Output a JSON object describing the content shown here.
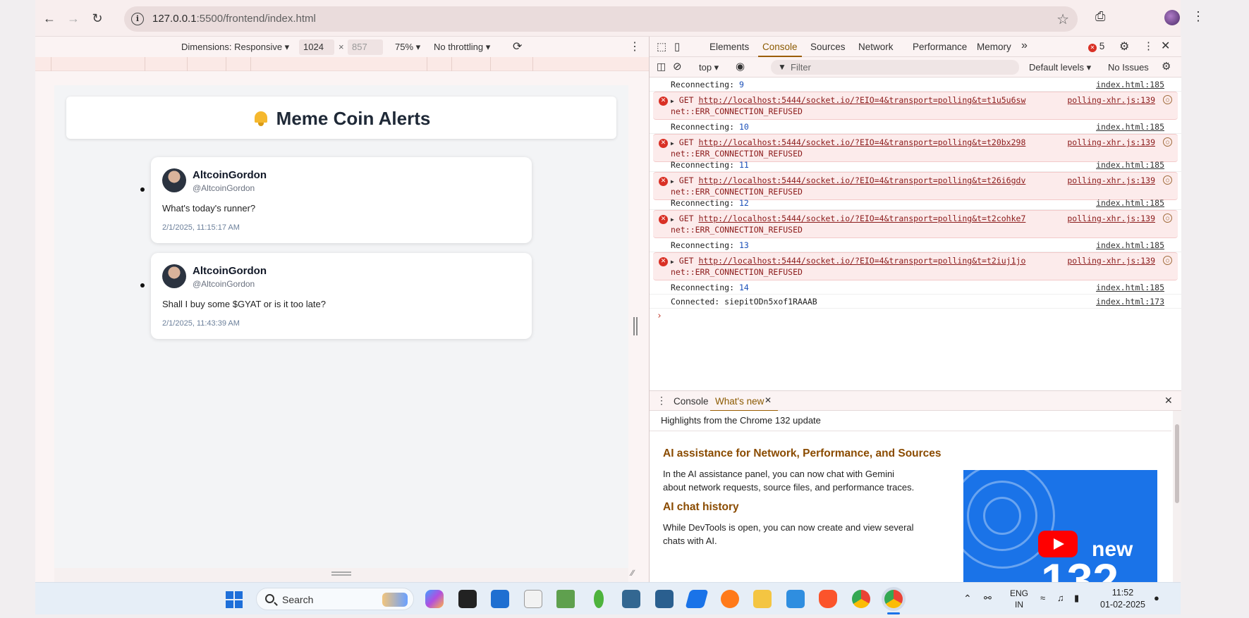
{
  "browser": {
    "url_host": "127.0.0.1",
    "url_path": ":5500/frontend/index.html"
  },
  "device_toolbar": {
    "dimensions_label": "Dimensions: Responsive ▾",
    "width": "1024",
    "x": "×",
    "height": "857",
    "zoom": "75% ▾",
    "throttling": "No throttling ▾"
  },
  "app": {
    "title": "Meme Coin Alerts",
    "tweets": [
      {
        "name": "AltcoinGordon",
        "handle": "@AltcoinGordon",
        "text": "What's today's runner?",
        "time": "2/1/2025, 11:15:17 AM"
      },
      {
        "name": "AltcoinGordon",
        "handle": "@AltcoinGordon",
        "text": "Shall I buy some $GYAT or is it too late?",
        "time": "2/1/2025, 11:43:39 AM"
      }
    ]
  },
  "devtools": {
    "tabs": [
      "Elements",
      "Console",
      "Sources",
      "Network",
      "Performance",
      "Memory"
    ],
    "more_tabs": "»",
    "error_count": "5",
    "context": "top ▾",
    "filter_placeholder": "Filter",
    "levels": "Default levels ▾",
    "issues": "No Issues",
    "logs": [
      {
        "type": "info",
        "prefix": "Reconnecting: ",
        "num": "9",
        "src": "index.html:185"
      },
      {
        "type": "err",
        "method": "GET",
        "url": "http://localhost:5444/socket.io/?EIO=4&transport=polling&t=t1u5u6sw",
        "detail": "net::ERR_CONNECTION_REFUSED",
        "src": "polling-xhr.js:139"
      },
      {
        "type": "info",
        "prefix": "Reconnecting: ",
        "num": "10",
        "src": "index.html:185"
      },
      {
        "type": "err",
        "method": "GET",
        "url": "http://localhost:5444/socket.io/?EIO=4&transport=polling&t=t20bx298",
        "detail": "net::ERR_CONNECTION_REFUSED",
        "src": "polling-xhr.js:139"
      },
      {
        "type": "info",
        "prefix": "Reconnecting: ",
        "num": "11",
        "src": "index.html:185"
      },
      {
        "type": "err",
        "method": "GET",
        "url": "http://localhost:5444/socket.io/?EIO=4&transport=polling&t=t26i6gdv",
        "detail": "net::ERR_CONNECTION_REFUSED",
        "src": "polling-xhr.js:139"
      },
      {
        "type": "info",
        "prefix": "Reconnecting: ",
        "num": "12",
        "src": "index.html:185"
      },
      {
        "type": "err",
        "method": "GET",
        "url": "http://localhost:5444/socket.io/?EIO=4&transport=polling&t=t2cohke7",
        "detail": "net::ERR_CONNECTION_REFUSED",
        "src": "polling-xhr.js:139"
      },
      {
        "type": "info",
        "prefix": "Reconnecting: ",
        "num": "13",
        "src": "index.html:185"
      },
      {
        "type": "err",
        "method": "GET",
        "url": "http://localhost:5444/socket.io/?EIO=4&transport=polling&t=t2iuj1jo",
        "detail": "net::ERR_CONNECTION_REFUSED",
        "src": "polling-xhr.js:139"
      },
      {
        "type": "info",
        "prefix": "Reconnecting: ",
        "num": "14",
        "src": "index.html:185"
      },
      {
        "type": "info",
        "prefix": "Connected:  ",
        "num": "siepitODn5xof1RAAAB",
        "src": "index.html:173",
        "plain": true
      }
    ],
    "drawer": {
      "tab_console": "Console",
      "tab_whats_new": "What's new",
      "highlights": "Highlights from the Chrome 132 update",
      "h1": "AI assistance for Network, Performance, and Sources",
      "p1": "In the AI assistance panel, you can now chat with Gemini about network requests, source files, and performance traces.",
      "h2": "AI chat history",
      "p2": "While DevTools is open, you can now create and view several chats with AI.",
      "thumb_new": "new",
      "thumb_num": "132"
    }
  },
  "taskbar": {
    "search": "Search",
    "lang1": "ENG",
    "lang2": "IN",
    "time": "11:52",
    "date": "01-02-2025"
  },
  "colors": {
    "accent": "#8b5a00",
    "error": "#d93025",
    "link_blue": "#1a4fb8"
  }
}
